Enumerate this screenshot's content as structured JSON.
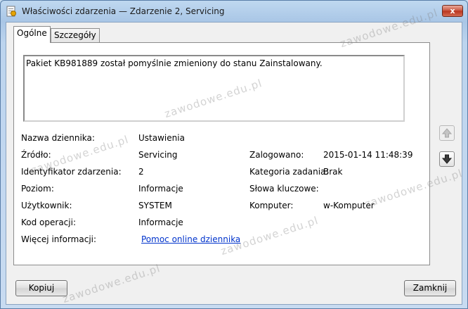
{
  "window": {
    "title": "Właściwości zdarzenia — Zdarzenie 2, Servicing",
    "close_label": "x"
  },
  "tabs": [
    {
      "label": "Ogólne",
      "active": true
    },
    {
      "label": "Szczegóły",
      "active": false
    }
  ],
  "description": "Pakiet KB981889 został pomyślnie zmieniony do stanu Zainstalowany.",
  "fields": {
    "log_name_label": "Nazwa dziennika:",
    "log_name_value": "Ustawienia",
    "source_label": "Źródło:",
    "source_value": "Servicing",
    "logged_label": "Zalogowano:",
    "logged_value": "2015-01-14 11:48:39",
    "event_id_label": "Identyfikator zdarzenia:",
    "event_id_value": "2",
    "task_category_label": "Kategoria zadania:",
    "task_category_value": "Brak",
    "level_label": "Poziom:",
    "level_value": "Informacje",
    "keywords_label": "Słowa kluczowe:",
    "keywords_value": "",
    "user_label": "Użytkownik:",
    "user_value": "SYSTEM",
    "computer_label": "Komputer:",
    "computer_value": "w-Komputer",
    "opcode_label": "Kod operacji:",
    "opcode_value": "Informacje",
    "more_info_label": "Więcej informacji:",
    "more_info_link": "Pomoc online dziennika"
  },
  "buttons": {
    "copy": "Kopiuj",
    "close": "Zamknij"
  },
  "watermark": "zawodowe.edu.pl",
  "icons": {
    "nav_up": "arrow-up-icon",
    "nav_down": "arrow-down-icon",
    "app": "event-properties-icon"
  }
}
